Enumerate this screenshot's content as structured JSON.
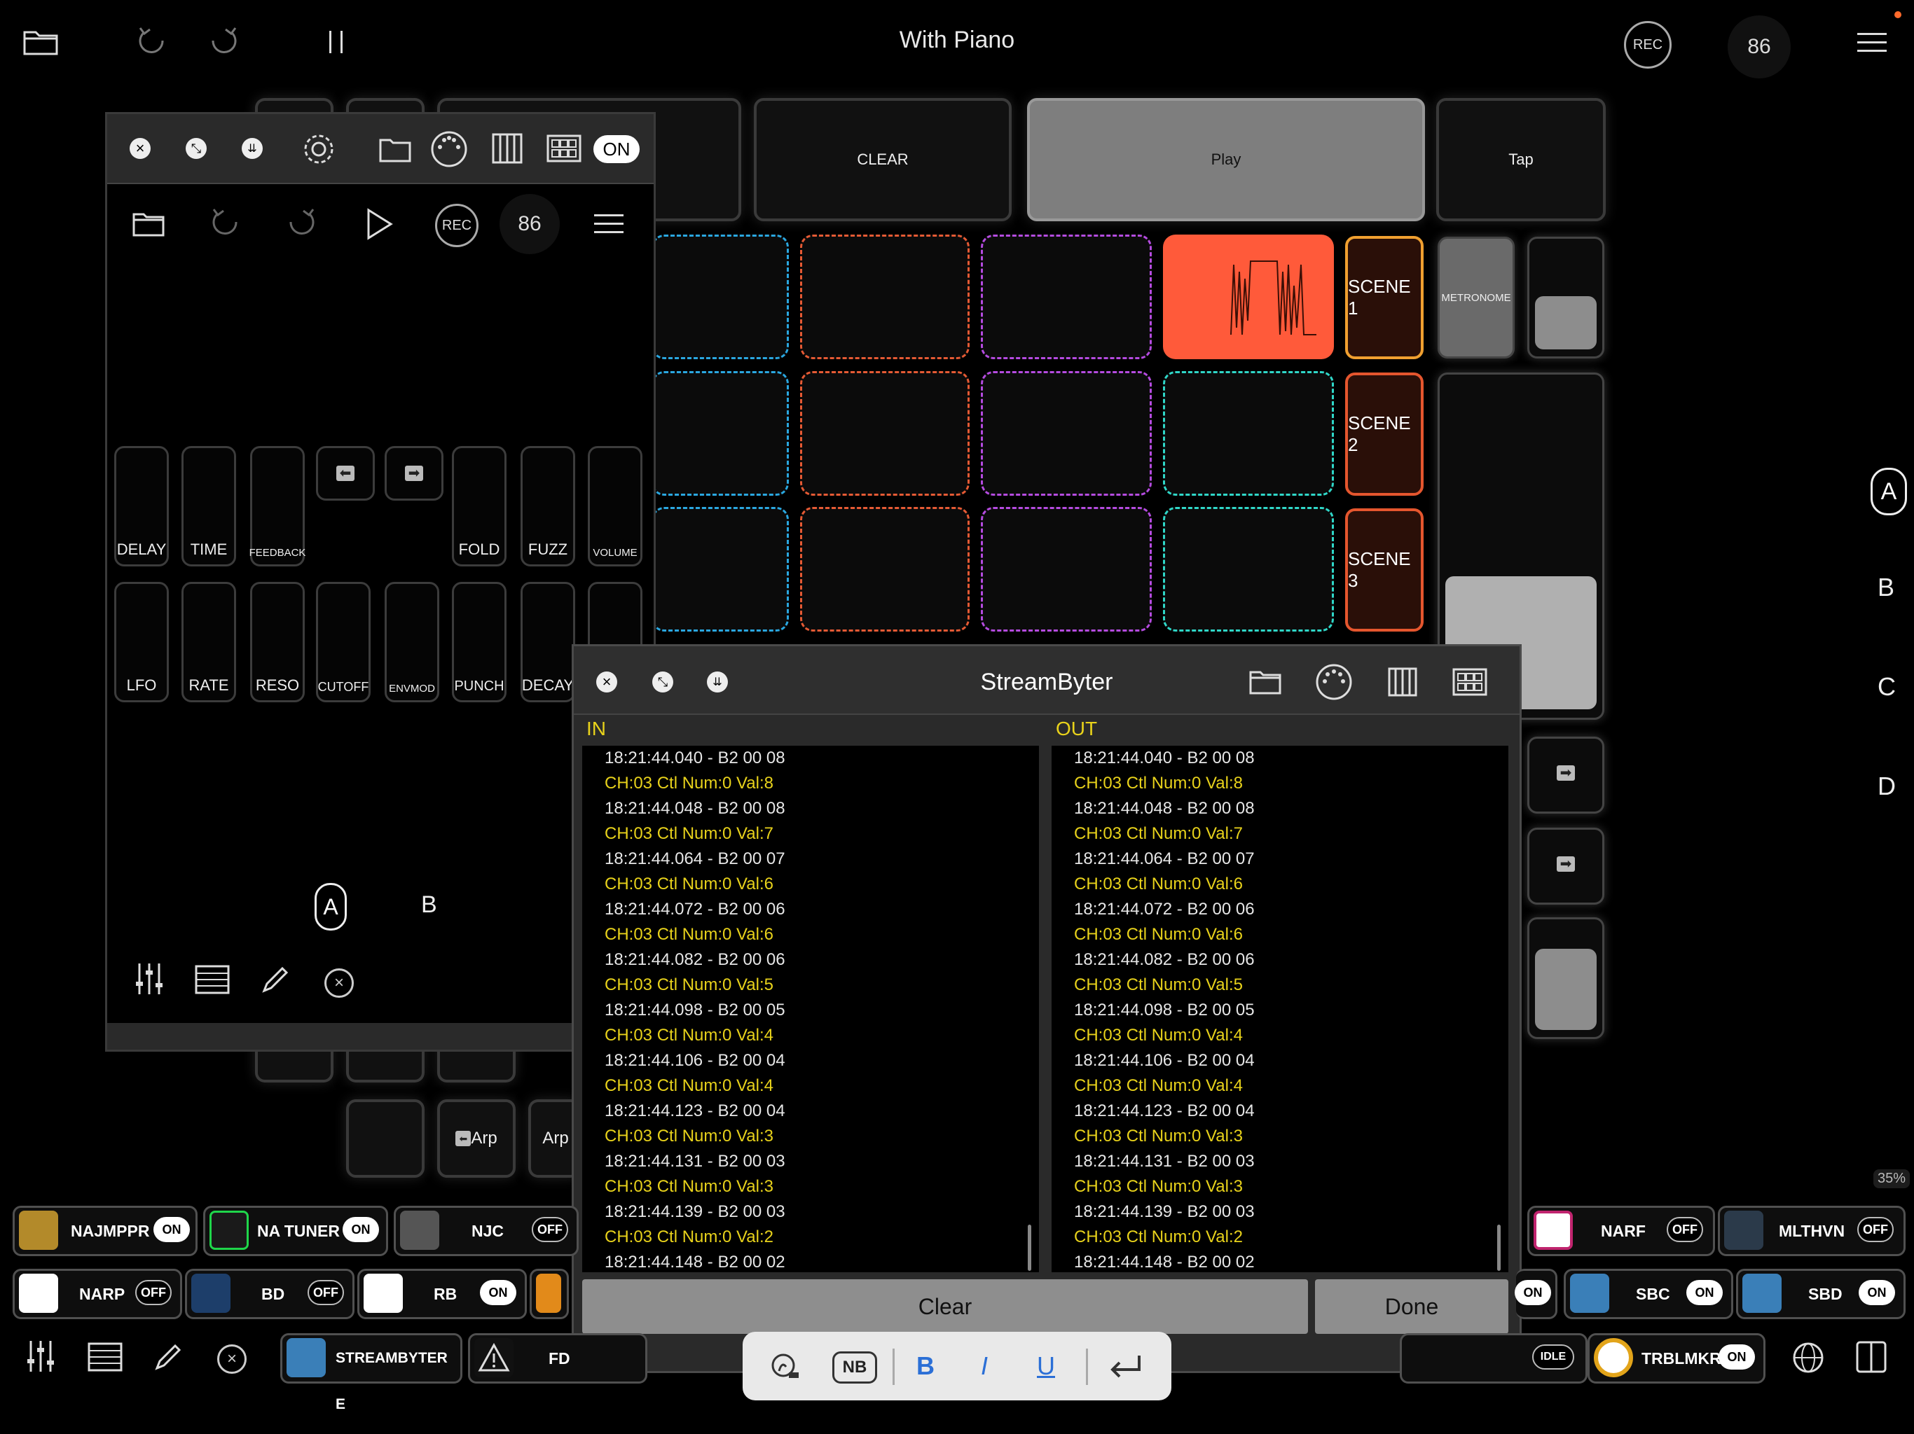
{
  "topbar": {
    "title": "With Piano",
    "rec": "REC",
    "tempo": "86"
  },
  "host": {
    "buttons": [
      "CLEAR",
      "Play",
      "Tap"
    ],
    "scenes": [
      "SCENE 1",
      "SCENE 2",
      "SCENE 3"
    ],
    "metronome": "METRONOME",
    "side_letters": [
      "A",
      "B",
      "C",
      "D"
    ],
    "arp_left": "Arp",
    "arp_right": "Arp",
    "cpu": "35%"
  },
  "pluginwin": {
    "on": "ON",
    "rec": "REC",
    "tempo": "86",
    "row1": [
      "DELAY",
      "TIME",
      "FEEDBACK",
      "",
      "",
      "FOLD",
      "FUZZ",
      "VOLUME"
    ],
    "row2": [
      "LFO",
      "RATE",
      "RESO",
      "CUTOFF",
      "ENVMOD",
      "PUNCH",
      "DECAY"
    ],
    "pages": [
      "A",
      "B"
    ]
  },
  "streambyter": {
    "title": "StreamByter",
    "in_label": "IN",
    "out_label": "OUT",
    "clear": "Clear",
    "done": "Done",
    "lines": [
      "18:21:44.040 - B2 00 08",
      "CH:03 Ctl Num:0 Val:8",
      "18:21:44.048 - B2 00 08",
      "CH:03 Ctl Num:0 Val:7",
      "18:21:44.064 - B2 00 07",
      "CH:03 Ctl Num:0 Val:6",
      "18:21:44.072 - B2 00 06",
      "CH:03 Ctl Num:0 Val:6",
      "18:21:44.082 - B2 00 06",
      "CH:03 Ctl Num:0 Val:5",
      "18:21:44.098 - B2 00 05",
      "CH:03 Ctl Num:0 Val:4",
      "18:21:44.106 - B2 00 04",
      "CH:03 Ctl Num:0 Val:4",
      "18:21:44.123 - B2 00 04",
      "CH:03 Ctl Num:0 Val:3",
      "18:21:44.131 - B2 00 03",
      "CH:03 Ctl Num:0 Val:3",
      "18:21:44.139 - B2 00 03",
      "CH:03 Ctl Num:0 Val:2",
      "18:21:44.148 - B2 00 02"
    ]
  },
  "strip": {
    "row1": [
      {
        "name": "NAJMPPR",
        "state": "ON"
      },
      {
        "name": "NA TUNER",
        "state": "ON"
      },
      {
        "name": "NJC",
        "state": "OFF"
      },
      {
        "name": "NARF",
        "state": "OFF"
      },
      {
        "name": "MLTHVN",
        "state": "OFF"
      }
    ],
    "row2": [
      {
        "name": "NARP",
        "state": "OFF"
      },
      {
        "name": "BD",
        "state": "OFF"
      },
      {
        "name": "RB",
        "state": "ON"
      },
      {
        "name": "",
        "state": "ON"
      },
      {
        "name": "SBC",
        "state": "ON"
      },
      {
        "name": "SBD",
        "state": "ON"
      }
    ],
    "row3": [
      {
        "name": "STREAMBYTER E"
      },
      {
        "name": "FD"
      },
      {
        "name": "",
        "state": "IDLE"
      },
      {
        "name": "TRBLMKR",
        "state": "ON"
      }
    ]
  },
  "format_bar": {
    "nb": "NB",
    "bold": "B",
    "italic": "I",
    "underline": "U"
  },
  "colors": {
    "accent_orange": "#ff5a3a",
    "blue": "#2aa7e0",
    "purple": "#b54be0",
    "teal": "#2fd7c8",
    "yellow": "#e8d21b"
  }
}
